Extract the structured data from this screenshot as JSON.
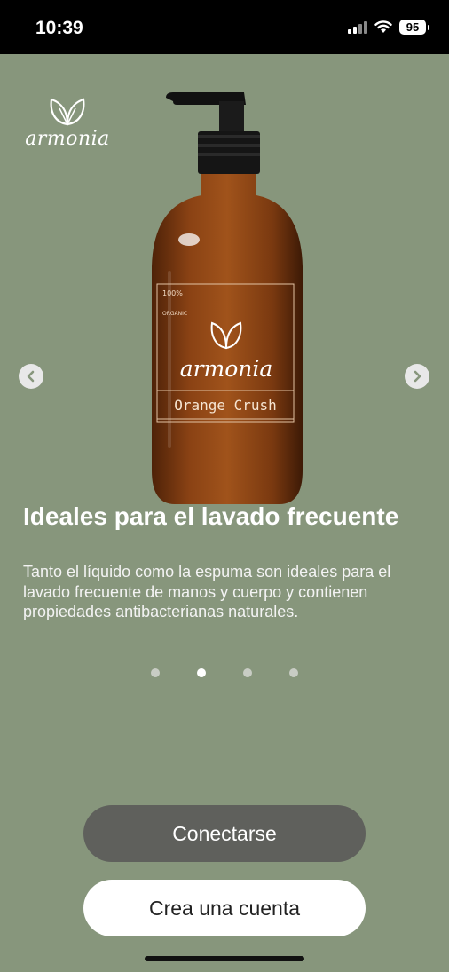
{
  "status_bar": {
    "time": "10:39",
    "battery": "95"
  },
  "brand": {
    "logo_text": "armonia"
  },
  "product": {
    "label_badge_1": "100%",
    "label_badge_2": "ORGANIC",
    "brand": "armonia",
    "name": "Orange Crush"
  },
  "slide": {
    "title": "Ideales para el lavado frecuente",
    "description": "Tanto el líquido como la espuma son ideales para el lavado frecuente de manos y cuerpo y contienen propiedades antibacterianas naturales."
  },
  "pager": {
    "count": 4,
    "active_index": 1
  },
  "actions": {
    "connect_label": "Conectarse",
    "create_label": "Crea una cuenta"
  },
  "colors": {
    "background": "#87967c",
    "connect_button": "#5f605c",
    "create_button": "#ffffff",
    "bottle_amber": "#8a4214"
  }
}
